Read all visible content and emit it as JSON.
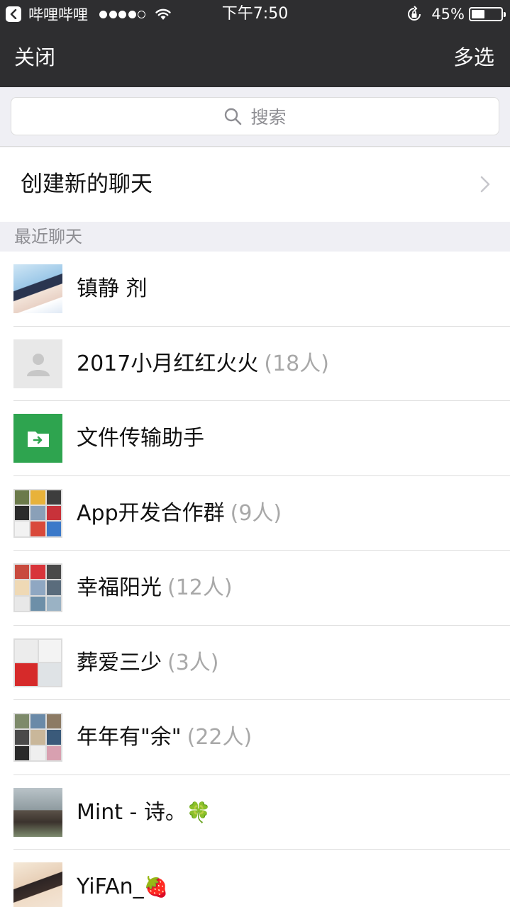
{
  "status_bar": {
    "app_name": "哔哩哔哩",
    "time": "下午7:50",
    "battery_percent": "45%",
    "battery_level": 0.45,
    "signal_bars_filled": 4,
    "signal_bars_total": 5
  },
  "nav": {
    "close_label": "关闭",
    "multi_select_label": "多选"
  },
  "search": {
    "placeholder": "搜索"
  },
  "create_chat": {
    "label": "创建新的聊天"
  },
  "section": {
    "recent_label": "最近聊天"
  },
  "chats": [
    {
      "name": "镇静 剂",
      "count": "",
      "avatar": "photo-girl"
    },
    {
      "name": "2017小月红红火火",
      "count": "(18人)",
      "avatar": "default-person"
    },
    {
      "name": "文件传输助手",
      "count": "",
      "avatar": "file-transfer-icon"
    },
    {
      "name": "App开发合作群",
      "count": "(9人)",
      "avatar": "group-grid-9"
    },
    {
      "name": "幸福阳光",
      "count": "(12人)",
      "avatar": "group-grid-9"
    },
    {
      "name": "葬爱三少",
      "count": "(3人)",
      "avatar": "group-grid-4"
    },
    {
      "name": "年年有\"余\"",
      "count": "(22人)",
      "avatar": "group-grid-9"
    },
    {
      "name": "Mint - 诗。",
      "count": "",
      "avatar": "photo-mint",
      "emoji": "🍀"
    },
    {
      "name": "YiFAn_",
      "count": "",
      "avatar": "photo-yifan",
      "emoji": "🍓"
    }
  ],
  "colors": {
    "header_bg": "#2e2e30",
    "page_bg": "#efeff4",
    "file_transfer_green": "#2ea44f",
    "secondary_text": "#a8a8a8"
  }
}
